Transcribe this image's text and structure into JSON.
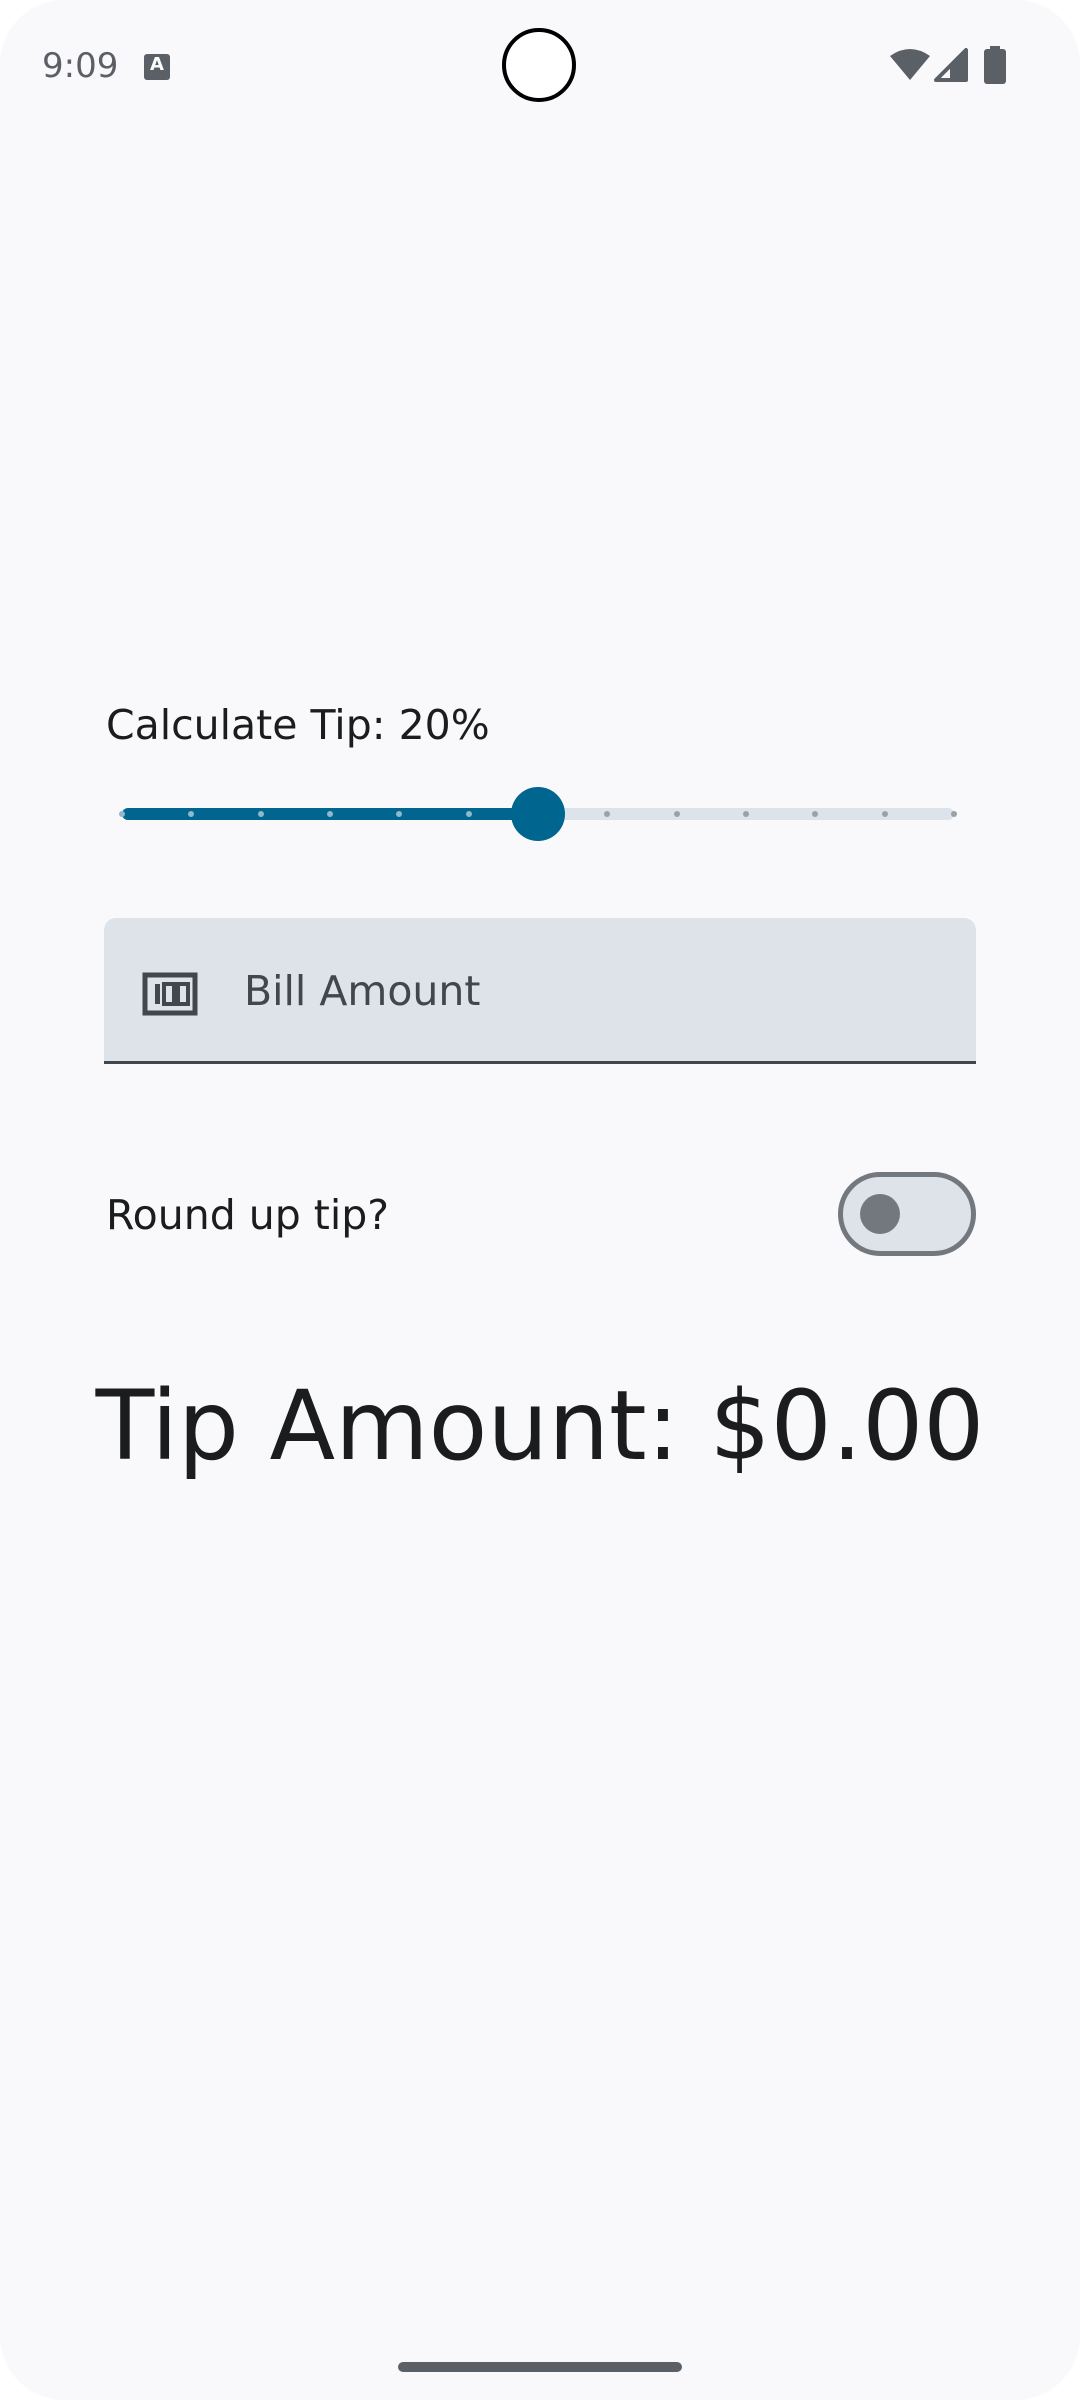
{
  "status_bar": {
    "time": "9:09",
    "notification_icon_letter": "A",
    "icons": [
      "wifi-icon",
      "cellular-signal-icon",
      "battery-icon"
    ]
  },
  "tip_slider": {
    "label": "Calculate Tip: 20%",
    "value_fraction": 0.5,
    "steps": 13,
    "active_color": "#00658f",
    "inactive_color": "#dde3ea"
  },
  "bill_field": {
    "placeholder": "Bill Amount",
    "value": "",
    "icon": "money-icon"
  },
  "round_up": {
    "label": "Round up tip?",
    "checked": false
  },
  "result": {
    "text": "Tip Amount: $0.00"
  },
  "colors": {
    "background": "#f9f9fc",
    "primary": "#00658f",
    "field_background": "#dee3ea",
    "outline": "#72787e"
  }
}
